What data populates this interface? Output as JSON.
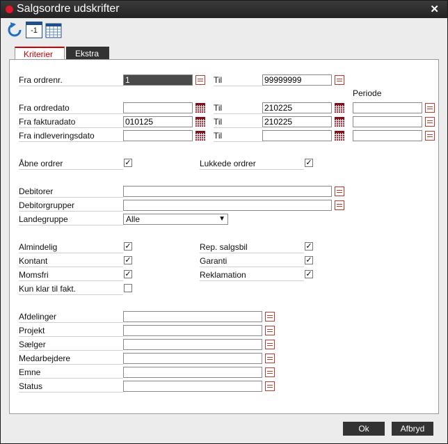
{
  "window": {
    "title": "Salgsordre udskrifter"
  },
  "toolbar": {
    "refresh_icon": "refresh-icon",
    "prev_icon": "calendar-minus-one-icon",
    "prev_label": "-1",
    "calendar_icon": "calendar-grid-icon"
  },
  "tabs": [
    {
      "label": "Kriterier",
      "active": true
    },
    {
      "label": "Ekstra",
      "active": false
    }
  ],
  "criteria": {
    "fra_ordrenr": {
      "label": "Fra ordrenr.",
      "value": "1"
    },
    "til_ordrenr": {
      "label": "Til",
      "value": "99999999"
    },
    "periode_label": "Periode",
    "fra_ordredato": {
      "label": "Fra ordredato",
      "value": ""
    },
    "til_ordredato": {
      "label": "Til",
      "value": "210225"
    },
    "periode_ordredato": {
      "value": ""
    },
    "fra_fakturadato": {
      "label": "Fra fakturadato",
      "value": "010125"
    },
    "til_fakturadato": {
      "label": "Til",
      "value": "210225"
    },
    "periode_fakturadato": {
      "value": ""
    },
    "fra_indleveringsdato": {
      "label": "Fra indleveringsdato",
      "value": ""
    },
    "til_indleveringsdato": {
      "label": "Til",
      "value": ""
    },
    "periode_indleveringsdato": {
      "value": ""
    },
    "aabne_ordrer": {
      "label": "Åbne ordrer",
      "checked": true
    },
    "lukkede_ordrer": {
      "label": "Lukkede ordrer",
      "checked": true
    },
    "debitorer": {
      "label": "Debitorer",
      "value": ""
    },
    "debitorgrupper": {
      "label": "Debitorgrupper",
      "value": ""
    },
    "landegruppe": {
      "label": "Landegruppe",
      "value": "Alle"
    },
    "almindelig": {
      "label": "Almindelig",
      "checked": true
    },
    "kontant": {
      "label": "Kontant",
      "checked": true
    },
    "momsfri": {
      "label": "Momsfri",
      "checked": true
    },
    "kun_klar": {
      "label": "Kun klar til fakt.",
      "checked": false
    },
    "rep_salgsbil": {
      "label": "Rep. salgsbil",
      "checked": true
    },
    "garanti": {
      "label": "Garanti",
      "checked": true
    },
    "reklamation": {
      "label": "Reklamation",
      "checked": true
    },
    "afdelinger": {
      "label": "Afdelinger",
      "value": ""
    },
    "projekt": {
      "label": "Projekt",
      "value": ""
    },
    "saelger": {
      "label": "Sælger",
      "value": ""
    },
    "medarbejdere": {
      "label": "Medarbejdere",
      "value": ""
    },
    "emne": {
      "label": "Emne",
      "value": ""
    },
    "status": {
      "label": "Status",
      "value": ""
    }
  },
  "buttons": {
    "ok": "Ok",
    "cancel": "Afbryd"
  },
  "colors": {
    "accent": "#cc0000",
    "titlebar": "#2b2b2b"
  }
}
